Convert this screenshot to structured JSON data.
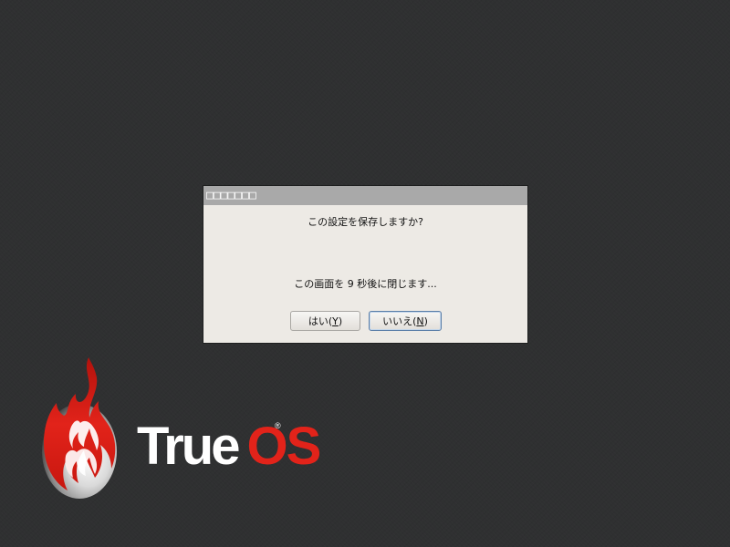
{
  "dialog": {
    "title": "□□□□□□□",
    "question": "この設定を保存しますか?",
    "countdown": "この画面を 9 秒後に閉じます...",
    "yes_button": {
      "label_main": "はい(",
      "mnemonic": "Y",
      "label_end": ")"
    },
    "no_button": {
      "label_main": "いいえ(",
      "mnemonic": "N",
      "label_end": ")"
    }
  },
  "branding": {
    "name_part1": "True",
    "name_part2": "OS",
    "registered_mark": "®",
    "logo_icon": "flame-globe-icon"
  },
  "colors": {
    "desktop_background": "#2f3031",
    "dialog_background": "#edeae5",
    "titlebar_background": "#a9a9a9",
    "brand_red": "#e2231a",
    "brand_white": "#ffffff"
  }
}
